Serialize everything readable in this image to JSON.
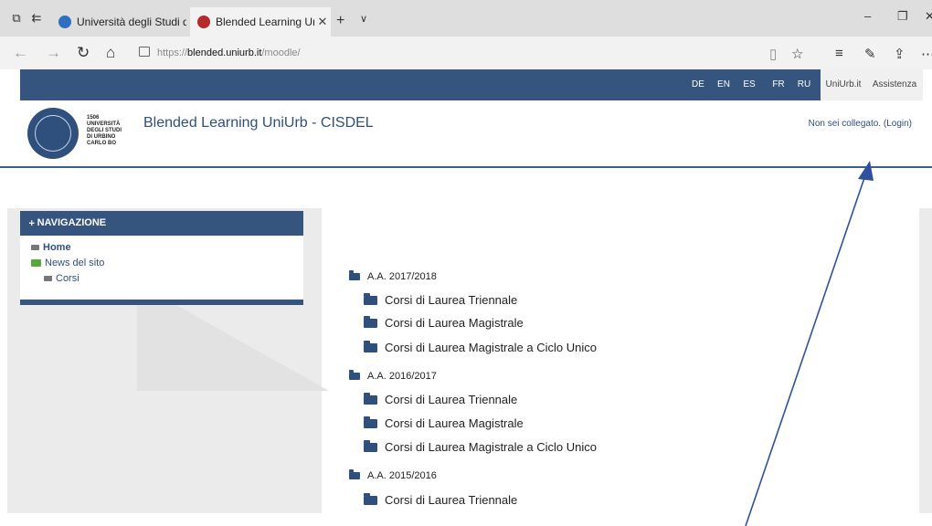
{
  "browser": {
    "tabs": [
      {
        "title": "Università degli Studi di Urb",
        "fav_color": "#2f6fbf"
      },
      {
        "title": "Blended Learning UniUr",
        "fav_color": "#b52a2a"
      }
    ],
    "url_prefix": "https://",
    "url_host": "blended.uniurb.it",
    "url_path": "/moodle/"
  },
  "languages": [
    "DE",
    "EN",
    "ES",
    "FR",
    "RU"
  ],
  "toplinks": [
    "UniUrb.it",
    "Assistenza"
  ],
  "header": {
    "uni_lines": [
      "1506",
      "UNIVERSITÀ",
      "DEGLI STUDI",
      "DI URBINO",
      "CARLO BO"
    ],
    "site_title": "Blended Learning UniUrb - CISDEL",
    "login_text": "Non sei collegato. (Login)"
  },
  "navigation": {
    "title": "NAVIGAZIONE",
    "items": [
      "Home",
      "News del sito",
      "Corsi"
    ]
  },
  "categories": [
    {
      "year": "A.A. 2017/2018",
      "courses": [
        "Corsi di Laurea Triennale",
        "Corsi di Laurea Magistrale",
        "Corsi di Laurea Magistrale a Ciclo Unico"
      ]
    },
    {
      "year": "A.A. 2016/2017",
      "courses": [
        "Corsi di Laurea Triennale",
        "Corsi di Laurea Magistrale",
        "Corsi di Laurea Magistrale a Ciclo Unico"
      ]
    },
    {
      "year": "A.A. 2015/2016",
      "courses": [
        "Corsi di Laurea Triennale"
      ]
    }
  ],
  "colors": {
    "brand": "#35557e",
    "link": "#2f4f7c",
    "news_icon": "#5aa83c"
  }
}
